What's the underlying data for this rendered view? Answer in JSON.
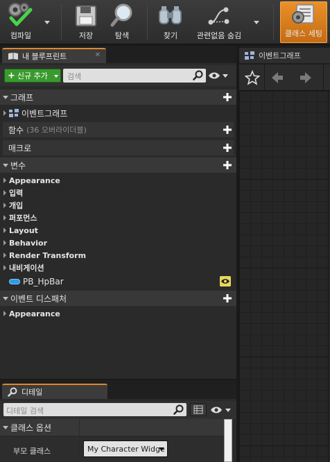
{
  "toolbar": {
    "compile": "컴파일",
    "save": "저장",
    "browse": "탐색",
    "find": "찾기",
    "hide_unrelated": "관련없음 숨김",
    "class_settings": "클래스 세팅"
  },
  "my_blueprint": {
    "tab_title": "내 블루프린트",
    "close": "✕",
    "add_new": "신규 추가",
    "search_placeholder": "검색",
    "graphs": {
      "label": "그래프",
      "items": [
        "이벤트그래프"
      ]
    },
    "functions": {
      "label": "함수",
      "override_note": "(36 오버라이더블)"
    },
    "macros": {
      "label": "매크로"
    },
    "variables": {
      "label": "변수",
      "groups": [
        "Appearance",
        "입력",
        "개입",
        "퍼포먼스",
        "Layout",
        "Behavior",
        "Render Transform",
        "내비게이션"
      ],
      "items": [
        {
          "name": "PB_HpBar",
          "type_color": "#2a9be8"
        }
      ]
    },
    "event_dispatchers": {
      "label": "이벤트 디스패처",
      "groups": [
        "Appearance"
      ]
    }
  },
  "graph_panel": {
    "tab_title": "이벤트그래프"
  },
  "details": {
    "tab_title": "디테일",
    "search_placeholder": "디테일 검색",
    "category": "클래스 옵션",
    "property_name": "부모 클래스",
    "property_value": "My Character Widge"
  },
  "colors": {
    "accent": "#e0892b",
    "add_button": "#3a9a2e",
    "class_settings_active": "#e9902a"
  }
}
